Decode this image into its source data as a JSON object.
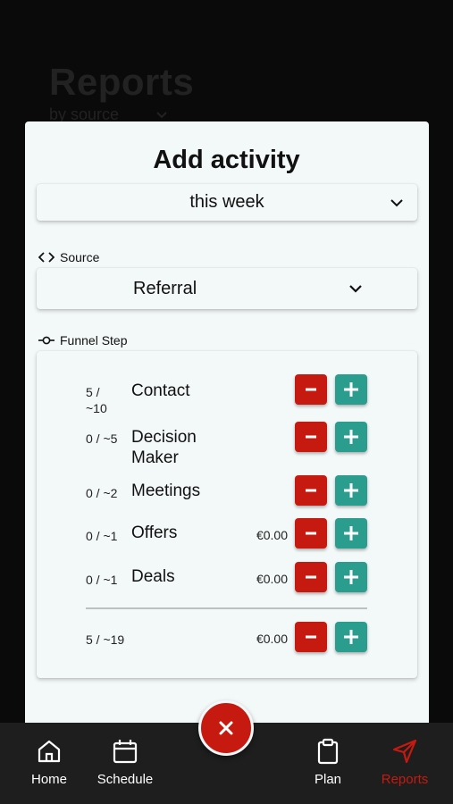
{
  "background": {
    "title": "Reports",
    "subtitle": "by source"
  },
  "modal": {
    "title": "Add activity",
    "period": {
      "value": "this week"
    },
    "source": {
      "label": "Source",
      "value": "Referral"
    },
    "funnel": {
      "label": "Funnel Step",
      "rows": [
        {
          "count": "5 / ~10",
          "name": "Contact",
          "amount": ""
        },
        {
          "count": "0 / ~5",
          "name": "Decision Maker",
          "amount": ""
        },
        {
          "count": "0 / ~2",
          "name": "Meetings",
          "amount": ""
        },
        {
          "count": "0 / ~1",
          "name": "Offers",
          "amount": "€0.00"
        },
        {
          "count": "0 / ~1",
          "name": "Deals",
          "amount": "€0.00"
        }
      ],
      "total": {
        "count": "5 / ~19",
        "amount": "€0.00"
      }
    }
  },
  "nav": {
    "items": [
      {
        "label": "Home",
        "icon": "home-icon"
      },
      {
        "label": "Schedule",
        "icon": "calendar-icon"
      },
      {
        "label": "Plan",
        "icon": "clipboard-icon"
      },
      {
        "label": "Reports",
        "icon": "send-icon"
      }
    ],
    "active": "Reports"
  },
  "fab": {
    "icon": "close-icon"
  },
  "colors": {
    "accent_red": "#c61a10",
    "accent_teal": "#2a9d8f",
    "modal_bg": "#f3f8f8",
    "nav_bg": "#1e1e1e"
  }
}
